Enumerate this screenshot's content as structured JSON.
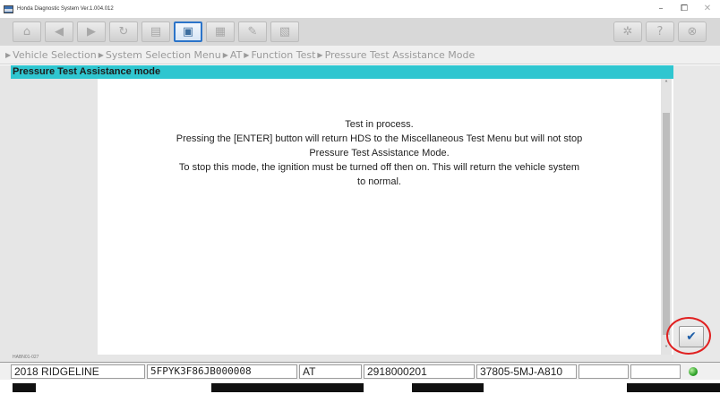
{
  "window": {
    "title": "Honda Diagnostic System Ver.1.004.012",
    "minimize": "–",
    "restore": "⧠",
    "close": "✕"
  },
  "toolbar": {
    "buttons": [
      {
        "name": "home",
        "glyph": "⌂"
      },
      {
        "name": "back",
        "glyph": "◀"
      },
      {
        "name": "forward",
        "glyph": "▶"
      },
      {
        "name": "refresh",
        "glyph": "↻"
      },
      {
        "name": "print",
        "glyph": "▤"
      },
      {
        "name": "screen",
        "glyph": "▣"
      },
      {
        "name": "snapshot",
        "glyph": "▦"
      },
      {
        "name": "note",
        "glyph": "✎"
      },
      {
        "name": "data",
        "glyph": "▧"
      },
      {
        "name": "settings",
        "glyph": "✲"
      },
      {
        "name": "help",
        "glyph": "?"
      },
      {
        "name": "exit",
        "glyph": "⊗"
      }
    ]
  },
  "breadcrumb": {
    "items": [
      "Vehicle Selection",
      "System Selection Menu",
      "AT",
      "Function Test",
      "Pressure Test Assistance Mode"
    ]
  },
  "header": {
    "title": "Pressure Test Assistance mode"
  },
  "message": {
    "line1": "Test in process.",
    "line2": "Pressing the [ENTER] button will return HDS to the Miscellaneous Test Menu but will not stop",
    "line3": "Pressure Test Assistance Mode.",
    "line4": "To stop this mode, the ignition must be turned off then on. This will return the vehicle system",
    "line5": "to normal."
  },
  "screen_code": "HABN01-027",
  "confirm": {
    "glyph": "✔"
  },
  "status": {
    "model": "2018 RIDGELINE",
    "vin": "5FPYK3F86JB000008",
    "system": "AT",
    "ecu_id": "2918000201",
    "part_number": "37805-5MJ-A810",
    "extra1": "",
    "extra2": ""
  },
  "colors": {
    "header_bg": "#2fc6d0",
    "highlight": "#e02020",
    "confirm_check": "#1f5fa8",
    "status_ok": "#2fa32a"
  }
}
